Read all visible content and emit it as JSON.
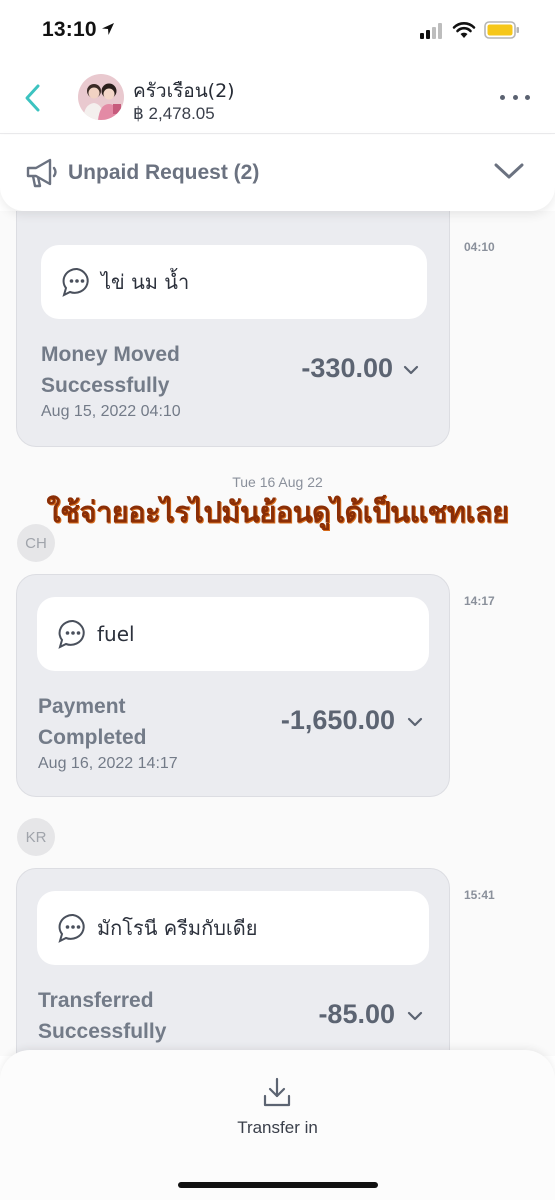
{
  "status_bar": {
    "time": "13:10"
  },
  "header": {
    "group_name": "ครัวเรือน(2)",
    "balance": "฿ 2,478.05"
  },
  "unpaid": {
    "label": "Unpaid Request (2)"
  },
  "messages": [
    {
      "note": "ไข่ นม น้ำ",
      "status": "Money Moved Successfully",
      "date": "Aug 15, 2022 04:10",
      "amount": "-330.00",
      "time": "04:10"
    },
    {
      "note": "fuel",
      "status": "Payment Completed",
      "date": "Aug 16, 2022 14:17",
      "amount": "-1,650.00",
      "time": "14:17"
    },
    {
      "note": "มักโรนี ครีมกับเดีย",
      "status": "Transferred Successfully",
      "date": "",
      "amount": "-85.00",
      "time": "15:41"
    }
  ],
  "day_separator": "Tue 16 Aug 22",
  "banner_text": "ใช้จ่ายอะไรไปมันย้อนดูได้เป็นแชทเลย",
  "senders": [
    "CH",
    "KR"
  ],
  "bottom": {
    "transfer_label": "Transfer in"
  },
  "colors": {
    "accent": "#3cc3c0",
    "banner": "#8a2e06"
  },
  "icons": [
    "back-icon",
    "more-icon",
    "megaphone-icon",
    "chevron-down-icon",
    "note-icon",
    "download-icon"
  ]
}
